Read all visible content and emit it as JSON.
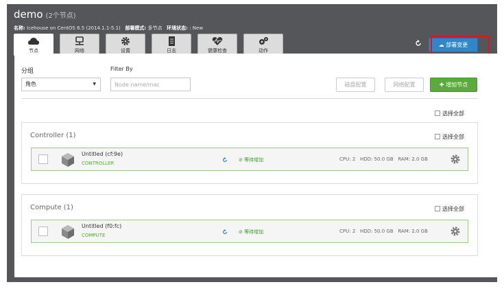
{
  "header": {
    "title": "demo",
    "subtitle": "(2个节点)",
    "name_label": "名称:",
    "name_value": "Icehouse on CentOS 6.5 (2014.1.1-5.1)",
    "mode_label": "部署模式:",
    "mode_value": "多节点",
    "status_label": "环境状态:",
    "status_value": ": New"
  },
  "tabs": [
    {
      "label": "节点",
      "icon": "cloud-icon"
    },
    {
      "label": "网络",
      "icon": "network-icon"
    },
    {
      "label": "设置",
      "icon": "gear-icon"
    },
    {
      "label": "日志",
      "icon": "log-icon"
    },
    {
      "label": "健康检查",
      "icon": "heart-icon"
    },
    {
      "label": "动作",
      "icon": "gears-icon"
    }
  ],
  "actions": {
    "deploy_label": "部署变更"
  },
  "toolbar": {
    "group_label": "分组",
    "group_value": "角色",
    "filter_label": "Filter By",
    "filter_placeholder": "Node name/mac",
    "disk_config": "磁盘配置",
    "nic_config": "网络配置",
    "add_node": "增加节点",
    "select_all": "选择全部"
  },
  "groups": [
    {
      "title": "Controller (1)",
      "select_all": "选择全部",
      "node": {
        "name": "Untitled (cf:9e)",
        "role": "CONTROLLER",
        "status": "⊘ 等待增加",
        "cpu": "CPU: 2",
        "hdd": "HDD: 50.0 GB",
        "ram": "RAM: 2.0 GB"
      }
    },
    {
      "title": "Compute (1)",
      "select_all": "选择全部",
      "node": {
        "name": "Untitled (f0:fc)",
        "role": "COMPUTE",
        "status": "⊘ 等待增加",
        "cpu": "CPU: 2",
        "hdd": "HDD: 50.0 GB",
        "ram": "RAM: 2.0 GB"
      }
    }
  ],
  "colors": {
    "frame": "#545659",
    "deploy": "#2f86c9",
    "add": "#5aaa3c",
    "highlight": "#e0141b"
  }
}
